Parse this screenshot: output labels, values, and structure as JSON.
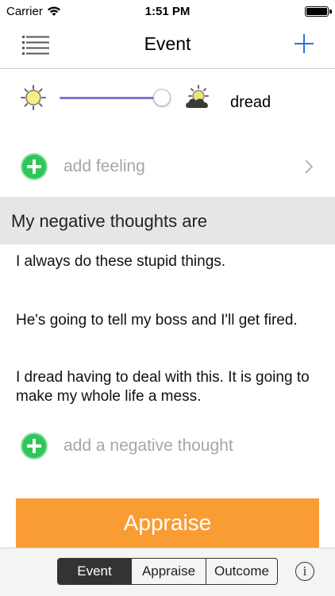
{
  "status_bar": {
    "carrier": "Carrier",
    "time": "1:51 PM",
    "battery_level": 1.0
  },
  "nav": {
    "title": "Event",
    "left_icon": "list-menu-icon",
    "right_icon": "plus-icon",
    "accent_color": "#2f6fe0"
  },
  "mood": {
    "left_icon": "sun-icon",
    "right_icon": "cloudy-sun-icon",
    "slider_value": 1.0,
    "slider_color": "#8a6fd1",
    "word": "dread"
  },
  "feeling": {
    "add_label": "add feeling"
  },
  "thoughts_section": {
    "title": "My negative thoughts are",
    "items": [
      "I always do these stupid things.",
      "He's going to tell my boss and I'll get fired.",
      "I dread having to deal with this.  It is going to make my whole life a mess."
    ],
    "add_label": "add a negative thought"
  },
  "action": {
    "appraise_label": "Appraise",
    "color": "#f99c34"
  },
  "toolbar": {
    "tabs": [
      {
        "label": "Event",
        "active": true
      },
      {
        "label": "Appraise",
        "active": false
      },
      {
        "label": "Outcome",
        "active": false
      }
    ],
    "info_glyph": "i"
  }
}
